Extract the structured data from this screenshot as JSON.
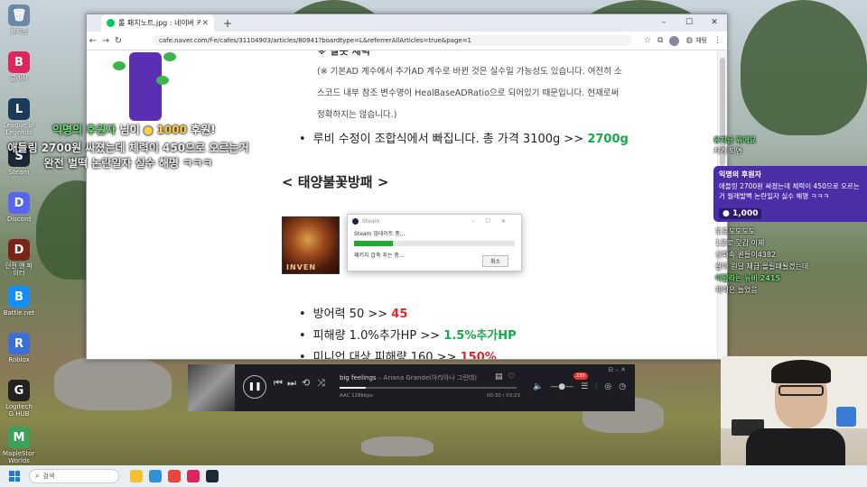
{
  "desktop": {
    "icons": [
      {
        "label": "휴지통",
        "glyph": "🗑",
        "color": "#6b88a8"
      },
      {
        "label": "클래식",
        "glyph": "B",
        "color": "#e0245e"
      },
      {
        "label": "League of Legends",
        "glyph": "L",
        "color": "#1a3a5c"
      },
      {
        "label": "Steam",
        "glyph": "S",
        "color": "#1b2838"
      },
      {
        "label": "Discord",
        "glyph": "D",
        "color": "#5865f2"
      },
      {
        "label": "던전 앤 파이터",
        "glyph": "D",
        "color": "#7a2418"
      },
      {
        "label": "Battle.net",
        "glyph": "B",
        "color": "#148eff"
      },
      {
        "label": "Roblox",
        "glyph": "R",
        "color": "#3b6fd8"
      },
      {
        "label": "Logitech G HUB",
        "glyph": "G",
        "color": "#222222"
      },
      {
        "label": "MapleStory Worlds",
        "glyph": "M",
        "color": "#3aa25a"
      }
    ]
  },
  "overlay_donation": {
    "nick": "익명의 후원자",
    "suffix": "님이",
    "amount": "1000",
    "unit": "후원!",
    "message": "애들링 2700원 싸졌는데 체력이 450으로 오르는거 완전 벌떡 논란일자 실수 해명 ㅋㅋㅋ"
  },
  "browser": {
    "tab_title": "롤 패치노트.jpg : 네이버 카페",
    "url": "cafe.naver.com/f-e/cafes/31104903/articles/80941?boardtype=L&referrerAllArticles=true&page=1",
    "chat_label": "채팅",
    "win_controls": [
      "–",
      "☐",
      "✕"
    ]
  },
  "article": {
    "section_head": "※ 잘못 체력",
    "note_lines": [
      "(※ 기본AD 계수에서 추가AD 계수로 바뀐 것은 실수일 가능성도 있습니다. 여전히 소",
      "스코드 내부 참조 변수명이 HealBaseADRatio으로 되어있기 때문입니다. 현재로써",
      "정확하지는 않습니다.)"
    ],
    "ruby_line_prefix": "루비 수정이 조합식에서 빠집니다. 총 가격 3100g >> ",
    "ruby_line_value": "2700g",
    "section_title": "< 태양불꽃방패 >",
    "item_image_text": "INVEN",
    "stats": [
      {
        "prefix": "방어력 50 >> ",
        "value": "45",
        "tone": "red"
      },
      {
        "prefix": "피해량 1.0%추가HP >> ",
        "value": "1.5%추가HP",
        "tone": "green"
      },
      {
        "prefix": "미니언 대상 피해량 160 >> ",
        "value": "150%",
        "tone": "red"
      }
    ]
  },
  "steam_dialog": {
    "title": "Steam",
    "status": "Steam 업데이트 중...",
    "progress": 0.24,
    "sub": "패키지 압축 푸는 중...",
    "cancel": "취소"
  },
  "player": {
    "song": "big feelings",
    "artist": "Ariana Grande(아리아나 그란데)",
    "format": "AAC 128kbps",
    "time": "00:30 / 03:23",
    "progress": 0.15,
    "badge": "230"
  },
  "chat": {
    "top_lines": [
      {
        "nick": "",
        "text": "유지님 뭐에요",
        "tone": "g"
      },
      {
        "nick": "",
        "text": "저게 되면",
        "tone": "w"
      }
    ],
    "donation_card": {
      "name": "익명의 후원자",
      "message": "애들링 2700원 싸졌는데 체력이 450으로 오르는거 월래발뻑 논란일자 실수 해명 ㅋㅋㅋ",
      "amount": "1,000"
    },
    "lines": [
      {
        "nick": "도도도도도도",
        "text": "",
        "tone": "w"
      },
      {
        "nick": "",
        "text": "1코로 뭇갑 이제",
        "tone": "w"
      },
      {
        "nick": "",
        "text": "신파속 퀸들이4382",
        "tone": "w"
      },
      {
        "nick": "",
        "text": "갈아 원딜 체급 올릴때될겠는데",
        "tone": "w"
      },
      {
        "nick": "",
        "text": "이말라는 뉴비 2415",
        "tone": "g"
      },
      {
        "nick": "",
        "text": "체력은 늘었음",
        "tone": "w"
      }
    ]
  },
  "taskbar": {
    "search_placeholder": "검색",
    "app_colors": [
      "#f2c12e",
      "#2f8fd8",
      "#e8453c",
      "#e0245e",
      "#1b2838"
    ]
  }
}
